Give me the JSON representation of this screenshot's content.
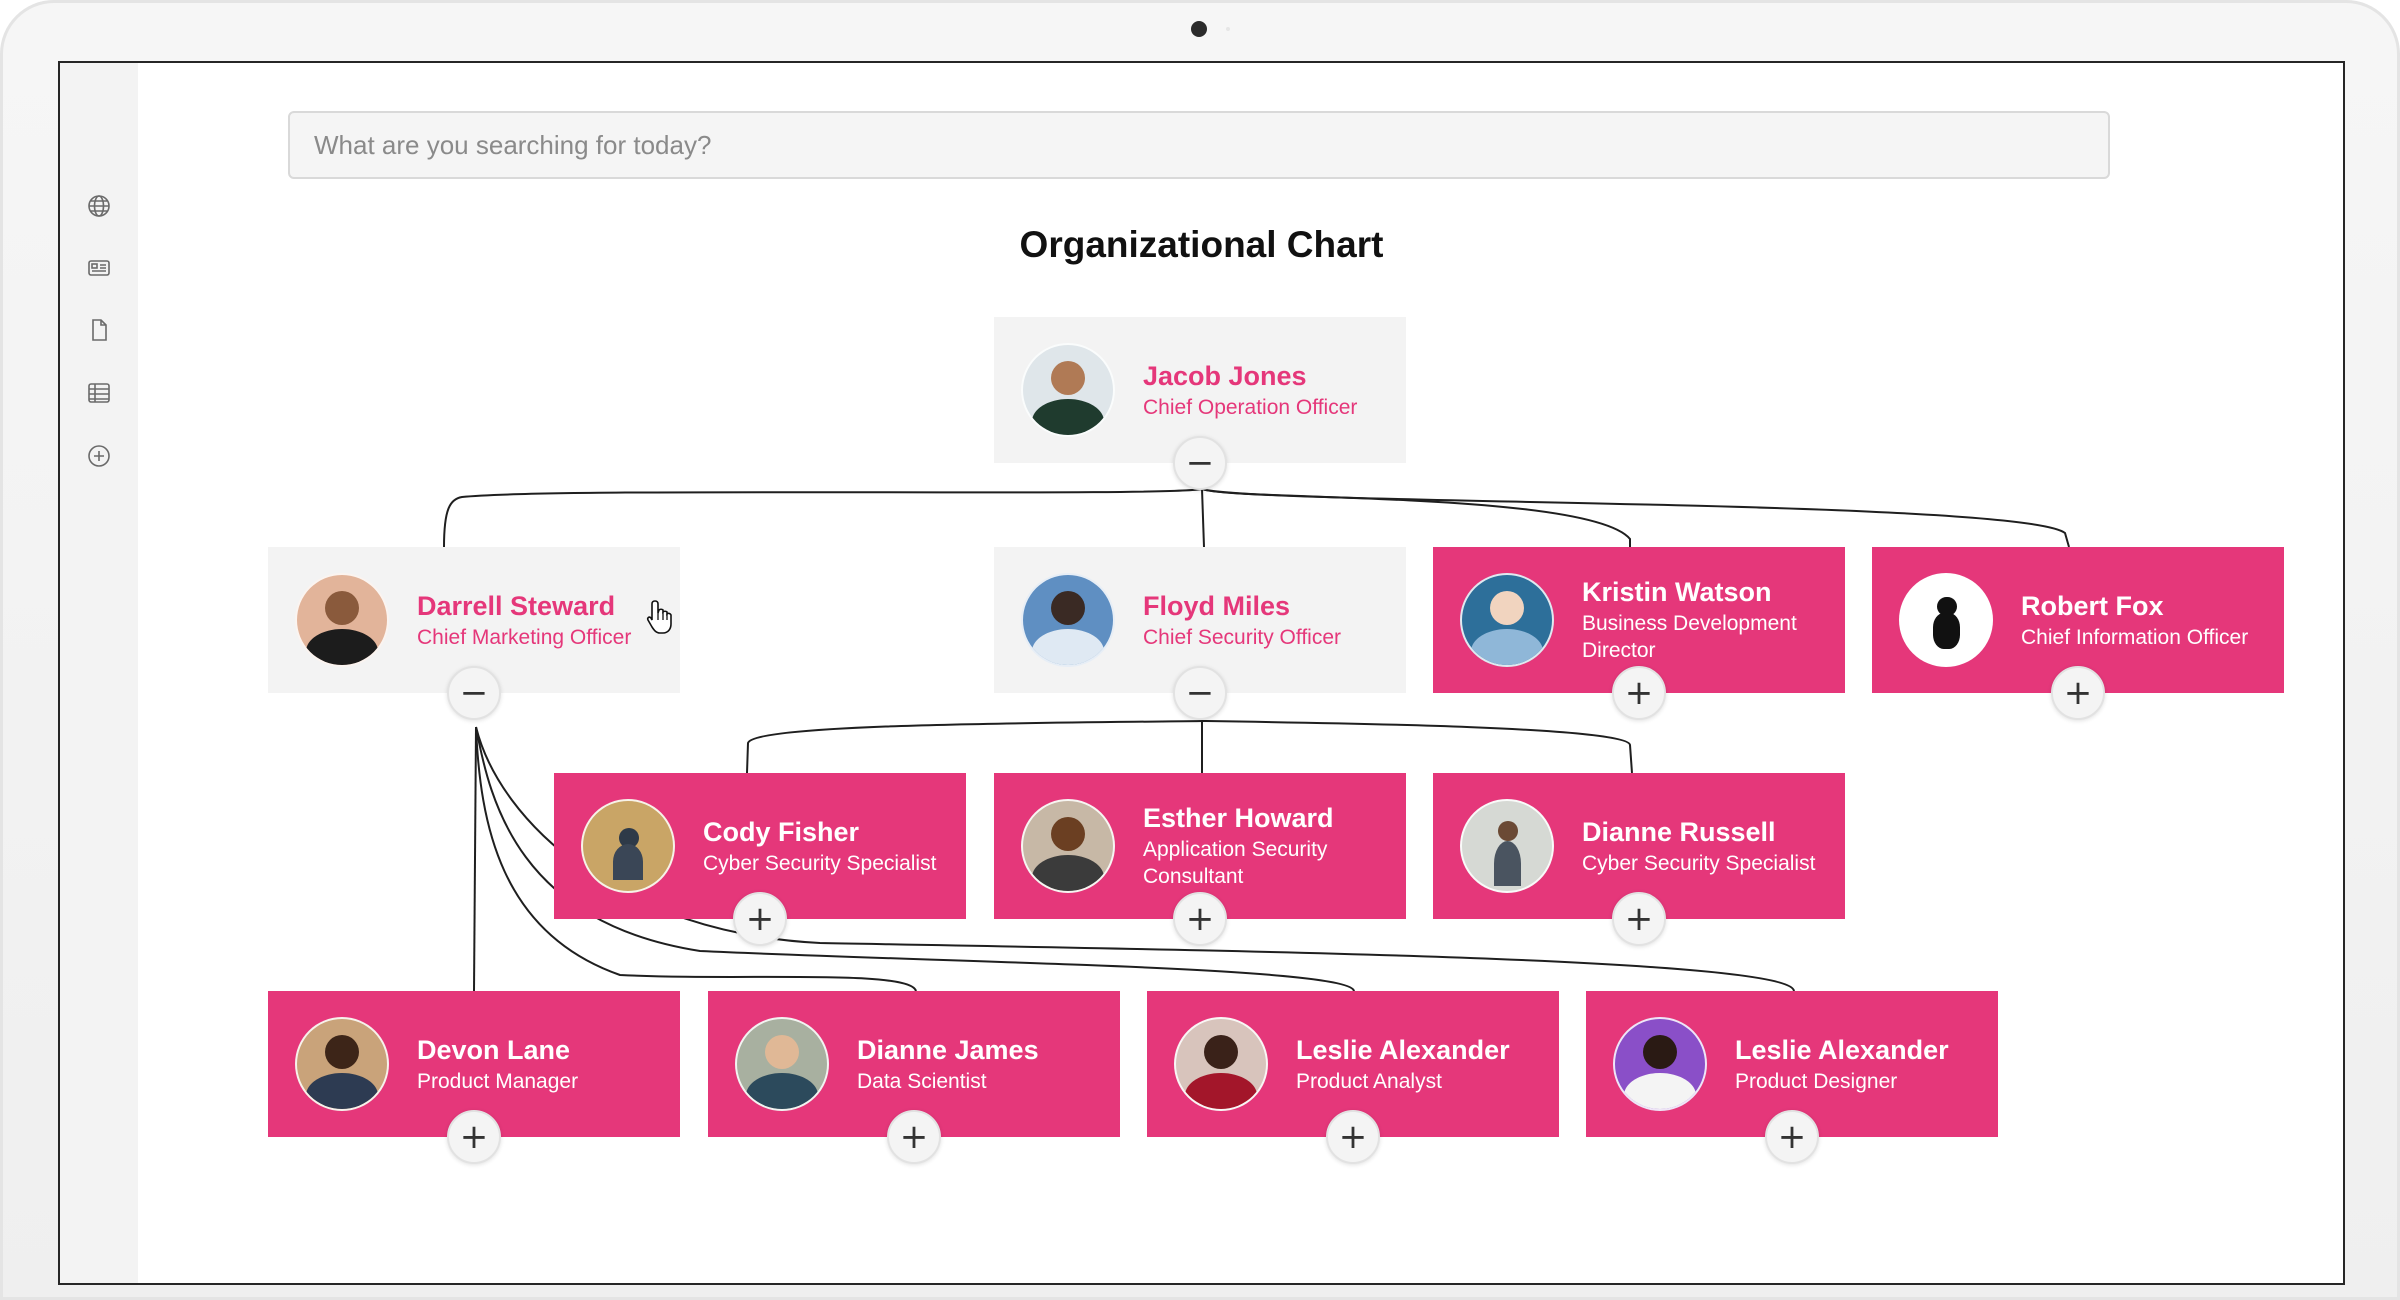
{
  "search": {
    "placeholder": "What are you searching for today?"
  },
  "sidebar": {
    "items": [
      {
        "icon": "globe-icon"
      },
      {
        "icon": "news-icon"
      },
      {
        "icon": "document-icon"
      },
      {
        "icon": "table-icon"
      },
      {
        "icon": "add-circle-icon"
      }
    ]
  },
  "title": "Organizational Chart",
  "colors": {
    "accent": "#e5377a",
    "card_inactive": "#f3f3f3"
  },
  "nodes": {
    "jacob": {
      "name": "Jacob Jones",
      "role": "Chief Operation Officer",
      "toggle": "−",
      "expanded": true
    },
    "darrell": {
      "name": "Darrell Steward",
      "role": "Chief Marketing Officer",
      "toggle": "−",
      "expanded": true
    },
    "floyd": {
      "name": "Floyd Miles",
      "role": "Chief Security Officer",
      "toggle": "−",
      "expanded": true
    },
    "kristin": {
      "name": "Kristin Watson",
      "role": "Business Development Director",
      "toggle": "+",
      "expanded": false
    },
    "robert": {
      "name": "Robert Fox",
      "role": "Chief Information Officer",
      "toggle": "+",
      "expanded": false
    },
    "cody": {
      "name": "Cody Fisher",
      "role": "Cyber Security Specialist",
      "toggle": "+",
      "expanded": false
    },
    "esther": {
      "name": "Esther Howard",
      "role": "Application Security Consultant",
      "toggle": "+",
      "expanded": false
    },
    "dianne_r": {
      "name": "Dianne Russell",
      "role": "Cyber Security Specialist",
      "toggle": "+",
      "expanded": false
    },
    "devon": {
      "name": "Devon Lane",
      "role": "Product Manager",
      "toggle": "+",
      "expanded": false
    },
    "dianne_j": {
      "name": "Dianne James",
      "role": "Data Scientist",
      "toggle": "+",
      "expanded": false
    },
    "leslie_a": {
      "name": "Leslie Alexander",
      "role": "Product Analyst",
      "toggle": "+",
      "expanded": false
    },
    "leslie_d": {
      "name": "Leslie Alexander",
      "role": "Product Designer",
      "toggle": "+",
      "expanded": false
    }
  }
}
